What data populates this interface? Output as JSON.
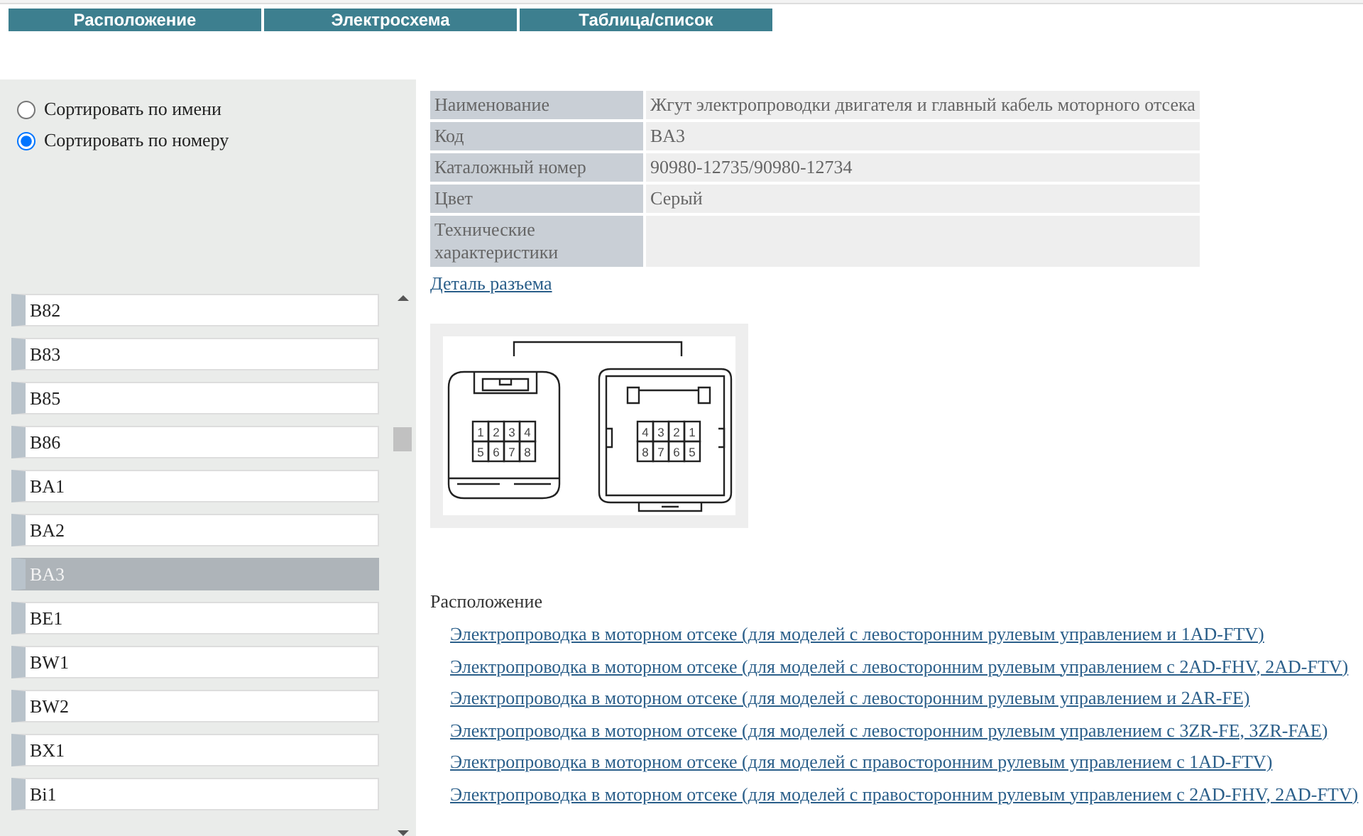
{
  "tabs": [
    {
      "label": "Расположение",
      "selected": false
    },
    {
      "label": "Электросхема",
      "selected": false
    },
    {
      "label": "Таблица/список",
      "selected": false
    }
  ],
  "sort_options": [
    {
      "label": "Сортировать по имени",
      "selected": false
    },
    {
      "label": "Сортировать по номеру",
      "selected": true
    }
  ],
  "connector_list": [
    {
      "label": "B82",
      "selected": false
    },
    {
      "label": "B83",
      "selected": false
    },
    {
      "label": "B85",
      "selected": false
    },
    {
      "label": "B86",
      "selected": false
    },
    {
      "label": "BA1",
      "selected": false
    },
    {
      "label": "BA2",
      "selected": false
    },
    {
      "label": "BA3",
      "selected": true
    },
    {
      "label": "BE1",
      "selected": false
    },
    {
      "label": "BW1",
      "selected": false
    },
    {
      "label": "BW2",
      "selected": false
    },
    {
      "label": "BX1",
      "selected": false
    },
    {
      "label": "Bi1",
      "selected": false
    }
  ],
  "details": [
    {
      "label": "Наименование",
      "value": "Жгут электропроводки двигателя и главный кабель моторного отсека"
    },
    {
      "label": "Код",
      "value": "BA3"
    },
    {
      "label": "Каталожный номер",
      "value": "90980-12735/90980-12734"
    },
    {
      "label": "Цвет",
      "value": "Серый"
    },
    {
      "label": "Технические характеристики"
    }
  ],
  "detail_link": "Деталь разъема",
  "connector": {
    "left_pins": [
      "1",
      "2",
      "3",
      "4",
      "5",
      "6",
      "7",
      "8"
    ],
    "right_pins": [
      "4",
      "3",
      "2",
      "1",
      "8",
      "7",
      "6",
      "5"
    ]
  },
  "location": {
    "title": "Расположение",
    "links": [
      "Электропроводка в моторном отсеке (для моделей с левосторонним рулевым управлением и 1AD-FTV)",
      "Электропроводка в моторном отсеке (для моделей с левосторонним рулевым управлением с 2AD-FHV, 2AD-FTV)",
      "Электропроводка в моторном отсеке (для моделей с левосторонним рулевым управлением и 2AR-FE)",
      "Электропроводка в моторном отсеке (для моделей с левосторонним рулевым управлением с 3ZR-FE, 3ZR-FAE)",
      "Электропроводка в моторном отсеке (для моделей с правосторонним рулевым управлением с 1AD-FTV)",
      "Электропроводка в моторном отсеке (для моделей с правосторонним рулевым управлением с 2AD-FHV, 2AD-FTV)"
    ]
  }
}
